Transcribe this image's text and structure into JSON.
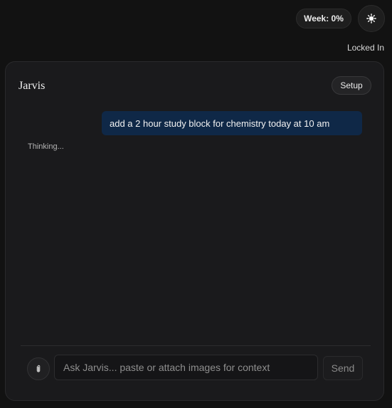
{
  "header": {
    "week_progress_label": "Week: 0%",
    "theme_icon": "sun-icon",
    "status": "Locked In"
  },
  "panel": {
    "title": "Jarvis",
    "setup_label": "Setup",
    "messages": [
      {
        "role": "user",
        "text": "add a 2 hour study block for chemistry today at 10 am"
      }
    ],
    "thinking_label": "Thinking..."
  },
  "composer": {
    "attach_icon": "paperclip-icon",
    "input_placeholder": "Ask Jarvis... paste or attach images for context",
    "input_value": "",
    "send_label": "Send"
  },
  "colors": {
    "background": "#121212",
    "panel": "#1a1a1c",
    "user_bubble": "#0f2847"
  }
}
